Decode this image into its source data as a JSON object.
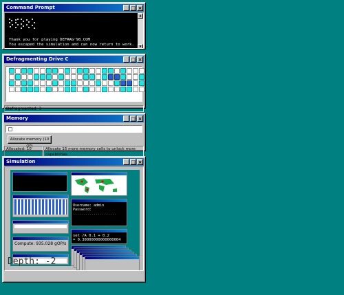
{
  "windows": {
    "cmd": {
      "title": "Command Prompt",
      "lines": [
        "Thank you for playing DEFRAG'98.COM",
        "You escaped the simulation and can now return to work."
      ]
    },
    "defrag": {
      "title": "Defragmenting Drive C",
      "status": "Defragmented: 3",
      "grid_rows": [
        "cwccwwccwcwccwwccwcwww",
        "wcwwcccwcwwwccwcbbcwwc",
        "cwccwwwcwccwwwcwwcbbwc",
        "wwcccwcwwccwcwwcwwccww"
      ]
    },
    "memory": {
      "title": "Memory",
      "button": "Allocate memory (10 OP)",
      "allocated": "Allocated: 10",
      "hint": "Allocate 15 more memory cells to unlock more capabilities."
    },
    "simulation": {
      "title": "Simulation",
      "depth": "Depth: -2",
      "nested": {
        "login_lines": [
          "Username: admin",
          "Password:"
        ],
        "calc_lines": [
          "set /A 0.1 + 0.2",
          "= 0.30000000000000004"
        ],
        "compute": "Compute: 935.028 gOP/s"
      }
    }
  },
  "colors": {
    "desktop": "#008080",
    "title_start": "#000080",
    "title_end": "#1084d0",
    "cell_cyan": "#25e4e4",
    "cell_blue": "#2b5fd0"
  },
  "icons": {
    "minimize": "minimize-icon",
    "maximize": "maximize-icon",
    "close": "close-icon"
  }
}
